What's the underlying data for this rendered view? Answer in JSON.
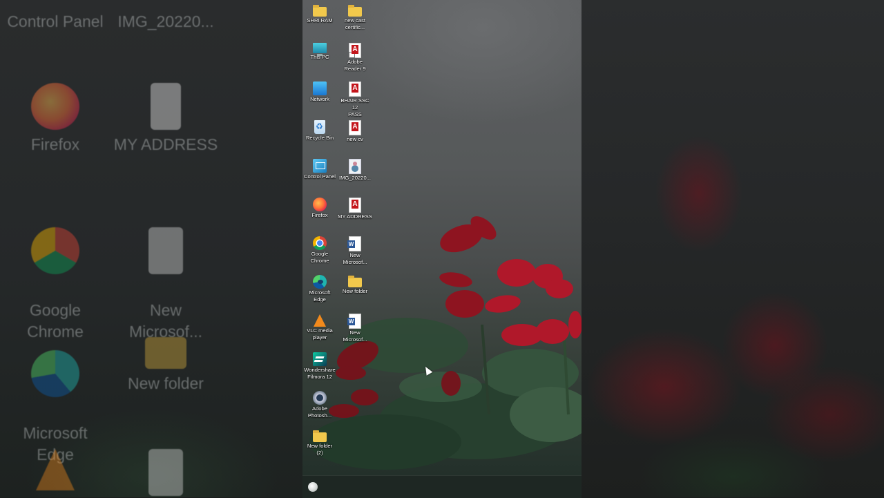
{
  "desktop_icons": [
    {
      "label": "SHRI RAM",
      "icon": "folder-icon"
    },
    {
      "label": "new cast\ncertific...",
      "icon": "folder-icon"
    },
    {
      "label": "This PC",
      "icon": "computer-icon"
    },
    {
      "label": "Adobe\nReader 9",
      "icon": "adobe-reader-icon"
    },
    {
      "label": "Network",
      "icon": "network-icon"
    },
    {
      "label": "BHAIR SSC 12\nPASS",
      "icon": "pdf-icon"
    },
    {
      "label": "Recycle Bin",
      "icon": "recycle-bin-icon"
    },
    {
      "label": "new cv",
      "icon": "pdf-icon"
    },
    {
      "label": "Control Panel",
      "icon": "control-panel-icon"
    },
    {
      "label": "IMG_20220...",
      "icon": "image-file-icon"
    },
    {
      "label": "Firefox",
      "icon": "firefox-icon"
    },
    {
      "label": "MY ADDRESS",
      "icon": "pdf-icon"
    },
    {
      "label": "Google\nChrome",
      "icon": "chrome-icon"
    },
    {
      "label": "New\nMicrosof...",
      "icon": "word-doc-icon"
    },
    {
      "label": "Microsoft\nEdge",
      "icon": "edge-icon"
    },
    {
      "label": "New folder",
      "icon": "folder-icon"
    },
    {
      "label": "VLC media\nplayer",
      "icon": "vlc-icon"
    },
    {
      "label": "New\nMicrosof...",
      "icon": "word-doc-icon"
    },
    {
      "label": "Wondershare\nFilmora 12",
      "icon": "filmora-icon"
    },
    {
      "label": "Adobe\nPhotosh...",
      "icon": "photoshop-icon"
    },
    {
      "label": "New folder\n(2)",
      "icon": "folder-icon"
    }
  ],
  "background_zoom_labels": {
    "left": [
      "Control Panel",
      "IMG_20220...",
      "Firefox",
      "MY ADDRESS",
      "Google\nChrome",
      "New\nMicrosof...",
      "Microsoft\nEdge",
      "New folder"
    ]
  },
  "colors": {
    "folder": "#f2c94c",
    "pdf_red": "#c4161c",
    "word_blue": "#2b5797",
    "taskbar": "#1e2723"
  }
}
